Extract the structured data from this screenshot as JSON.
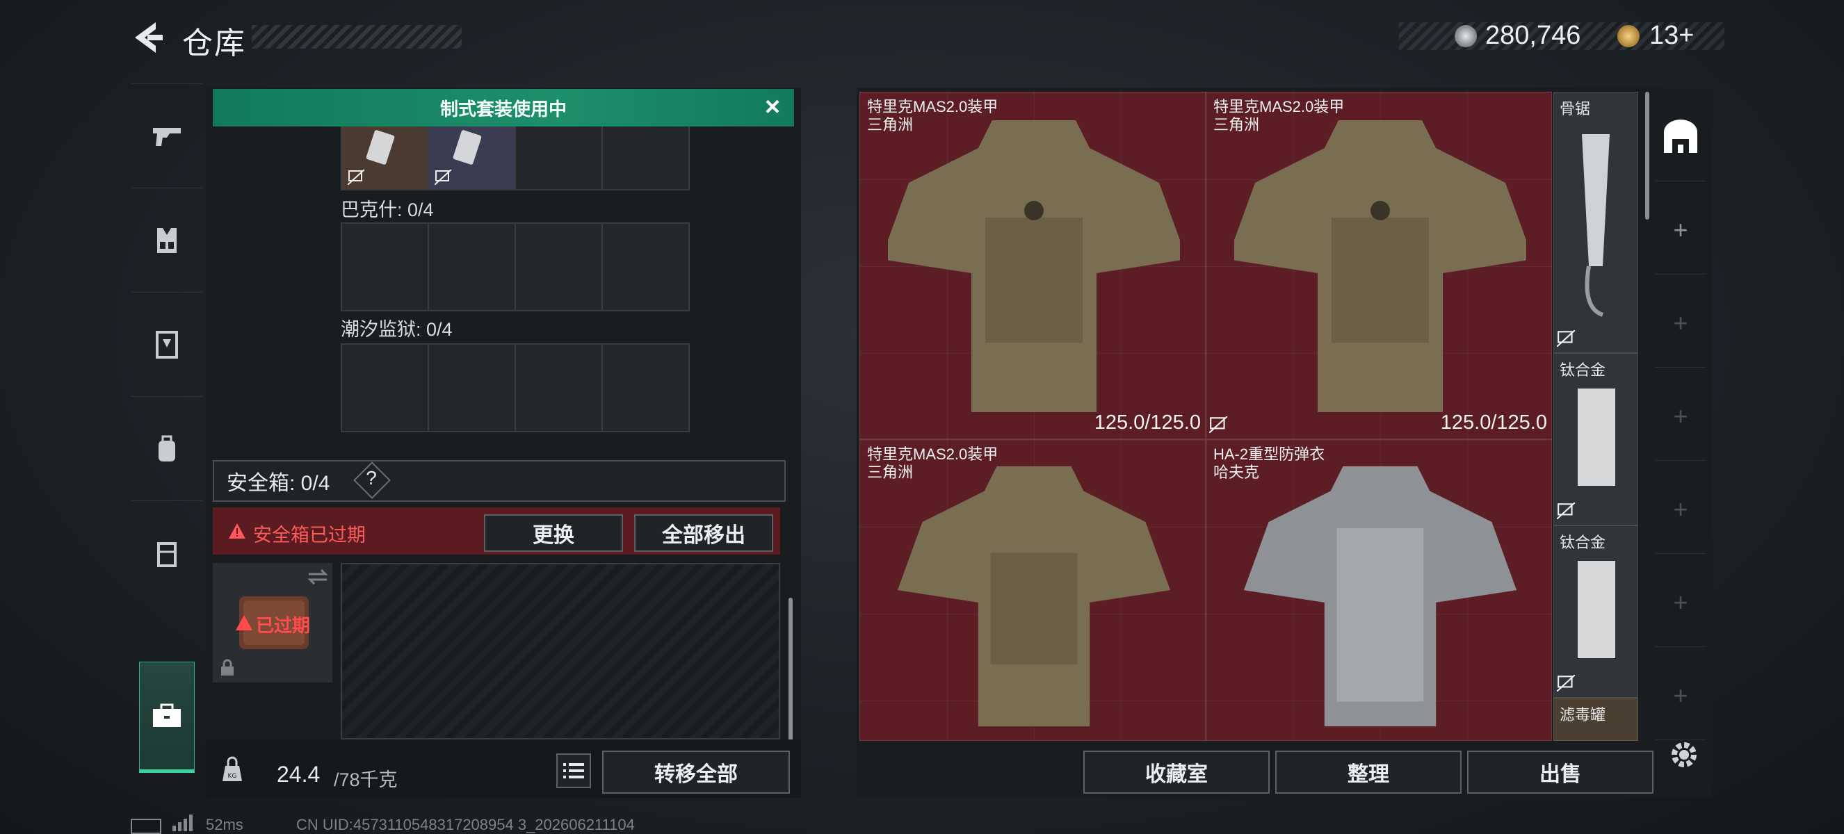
{
  "header": {
    "title": "仓库",
    "coins": "280,746",
    "tokens": "13+"
  },
  "left_nav": {
    "items": [
      {
        "icon": "gun-icon"
      },
      {
        "icon": "vest-icon"
      },
      {
        "icon": "armor-rig-icon"
      },
      {
        "icon": "backpack-icon"
      },
      {
        "icon": "pouch-icon"
      },
      {
        "icon": "briefcase-icon",
        "active": true
      }
    ]
  },
  "kit_panel": {
    "banner": "制式套装使用中",
    "groups": [
      {
        "label": "巴克什: 0/4"
      },
      {
        "label": "潮汐监狱: 0/4"
      }
    ],
    "safebox": {
      "label": "安全箱: 0/4",
      "help": "?",
      "warning": "安全箱已过期",
      "replace_label": "更换",
      "remove_all_label": "全部移出",
      "expired_label": "已过期"
    },
    "weight": {
      "value": "24.4",
      "unit": "/78千克"
    },
    "transfer_all_label": "转移全部"
  },
  "stash": {
    "items": [
      {
        "name": "特里克MAS2.0装甲",
        "origin": "三角洲",
        "durability": "125.0/125.0"
      },
      {
        "name": "特里克MAS2.0装甲",
        "origin": "三角洲",
        "durability": "125.0/125.0"
      },
      {
        "name": "特里克MAS2.0装甲",
        "origin": "三角洲",
        "durability": ""
      },
      {
        "name": "HA-2重型防弹衣",
        "origin": "哈夫克",
        "durability": ""
      }
    ],
    "small_items": [
      {
        "name": "骨锯"
      },
      {
        "name": "钛合金"
      },
      {
        "name": "钛合金"
      },
      {
        "name": "滤毒罐"
      }
    ],
    "collection_label": "收藏室",
    "sort_label": "整理",
    "sell_label": "出售"
  },
  "status": {
    "ping": "52ms",
    "uid": "CN UID:4573110548317208954 3_202606211104"
  },
  "colors": {
    "accent_green": "#1c8f6b",
    "stash_red": "#5c1d25",
    "warning_red": "#ff5a5a"
  }
}
